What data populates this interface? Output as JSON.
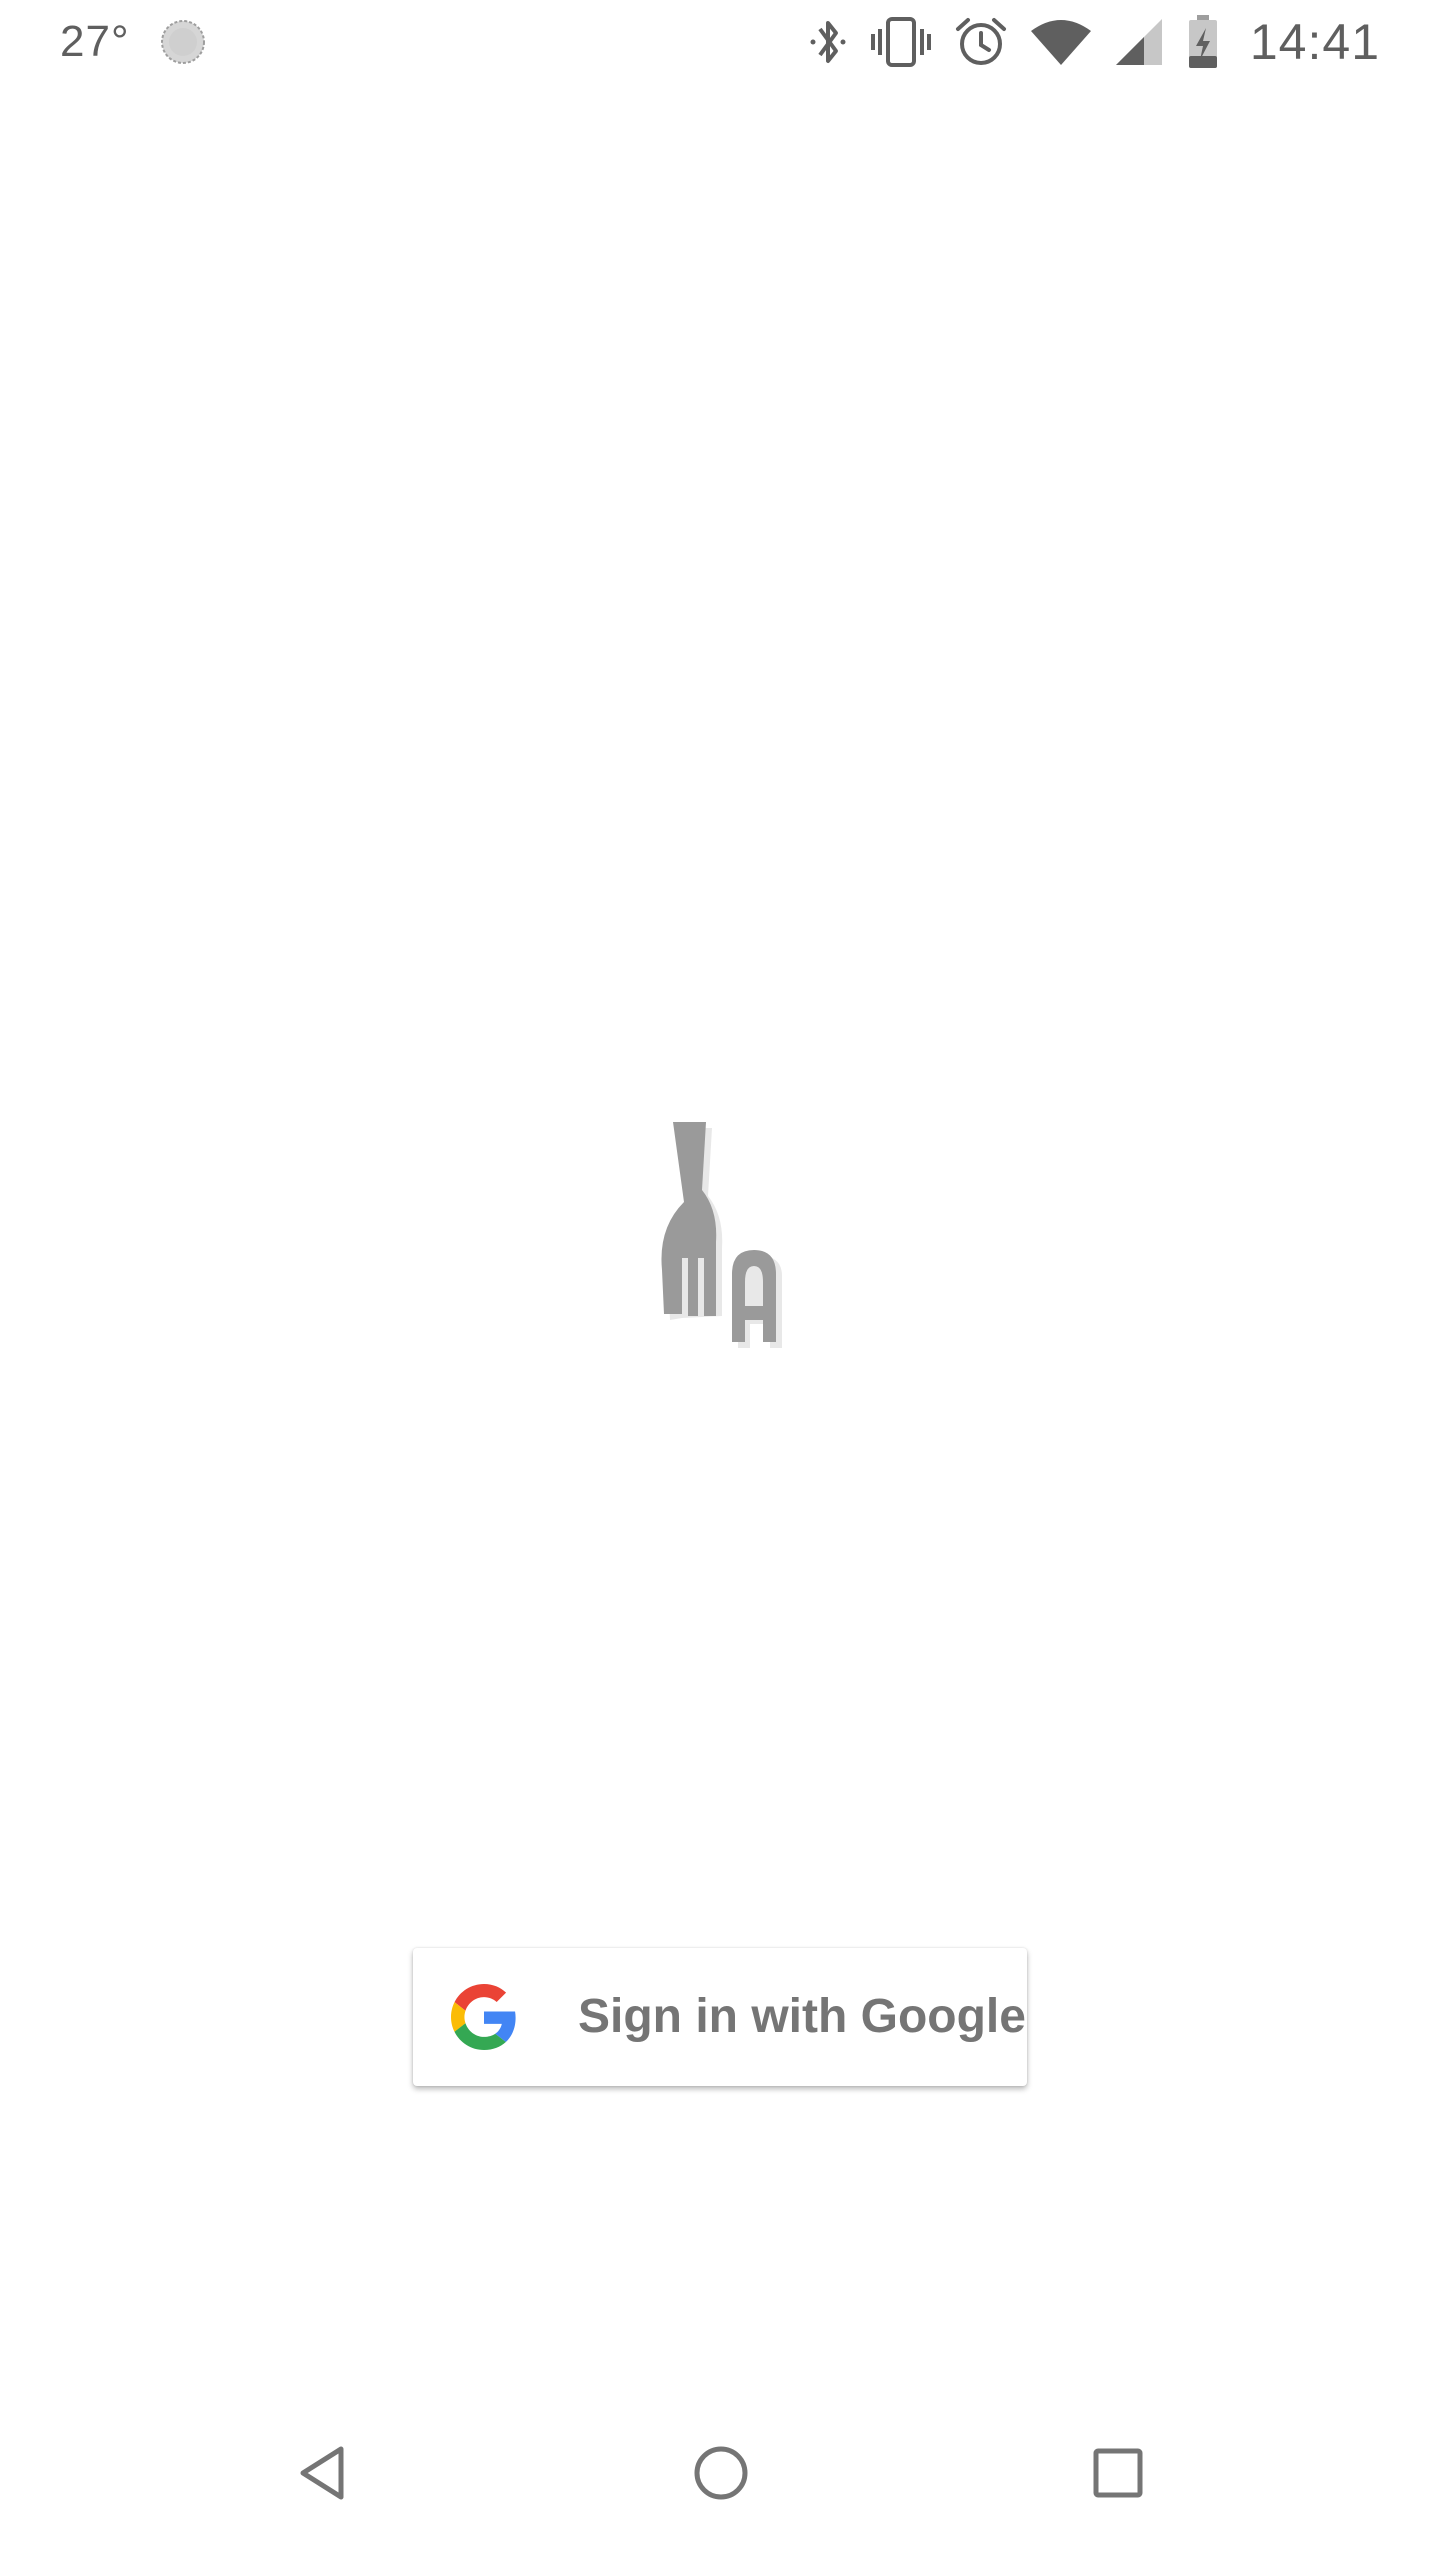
{
  "status_bar": {
    "temperature": "27°",
    "weather_icon": "weather-sun-icon",
    "icons": [
      "bluetooth-icon",
      "vibrate-icon",
      "alarm-icon",
      "wifi-icon",
      "cell-signal-icon",
      "battery-charging-icon"
    ],
    "time": "14:41"
  },
  "app": {
    "logo_icon": "fork-a-logo"
  },
  "signin": {
    "label": "Sign in with Google",
    "icon": "google-g-icon",
    "colors": {
      "blue": "#4285F4",
      "red": "#EA4335",
      "yellow": "#FBBC05",
      "green": "#34A853",
      "text": "#757575"
    }
  },
  "navigation": {
    "icons": [
      "back-icon",
      "home-icon",
      "recents-icon"
    ]
  }
}
